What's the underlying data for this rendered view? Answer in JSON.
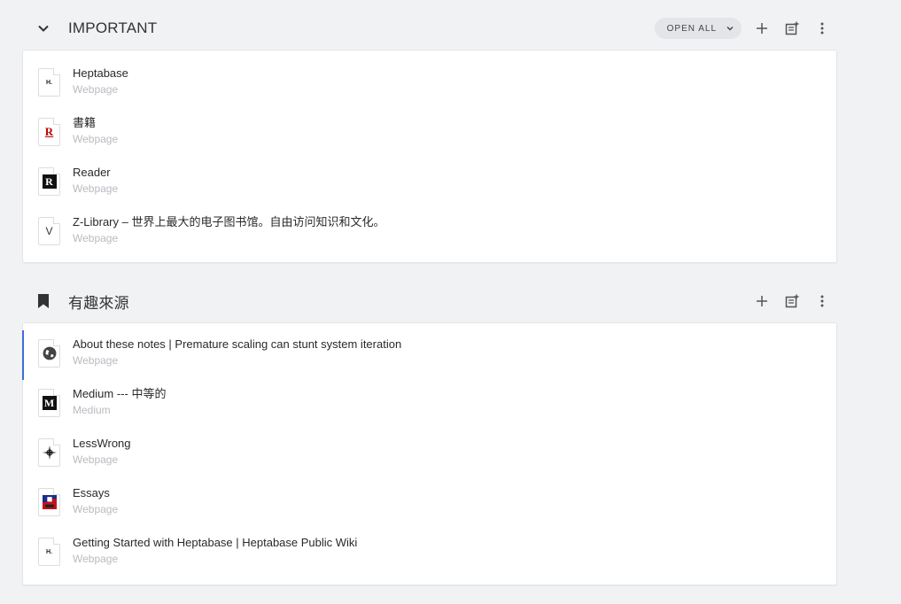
{
  "groups": [
    {
      "title": "IMPORTANT",
      "open_all_label": "OPEN ALL",
      "items": [
        {
          "title": "Heptabase",
          "subtitle": "Webpage"
        },
        {
          "title": "書籍",
          "subtitle": "Webpage"
        },
        {
          "title": "Reader",
          "subtitle": "Webpage"
        },
        {
          "title": "Z-Library – 世界上最大的电子图书馆。自由访问知识和文化。",
          "subtitle": "Webpage"
        }
      ]
    },
    {
      "title": "有趣來源",
      "items": [
        {
          "title": "About these notes | Premature scaling can stunt system iteration",
          "subtitle": "Webpage"
        },
        {
          "title": "Medium --- 中等的",
          "subtitle": "Medium"
        },
        {
          "title": "LessWrong",
          "subtitle": "Webpage"
        },
        {
          "title": "Essays",
          "subtitle": "Webpage"
        },
        {
          "title": "Getting Started with Heptabase | Heptabase Public Wiki",
          "subtitle": "Webpage"
        }
      ]
    }
  ],
  "favicons": {
    "heptabase": "H.",
    "rakuten": "R",
    "reader": "R",
    "zlib": "V",
    "medium": "M"
  },
  "colors": {
    "background": "#f1f2f4",
    "card": "#ffffff",
    "selected_accent": "#3a6fd8",
    "rakuten_red": "#bf0000",
    "subtitle": "#b9bbc0"
  }
}
